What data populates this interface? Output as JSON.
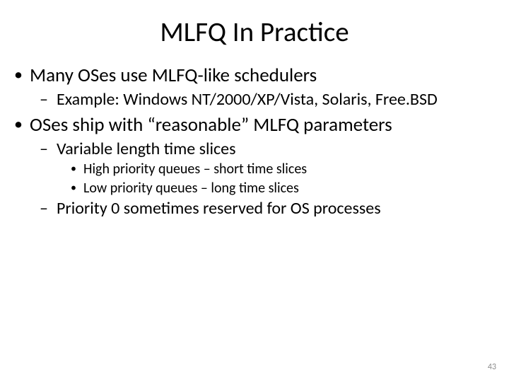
{
  "title": "MLFQ In Practice",
  "bullets": {
    "b1": "Many OSes use MLFQ-like schedulers",
    "b1_1": "Example: Windows NT/2000/XP/Vista, Solaris, Free.BSD",
    "b2": "OSes ship with “reasonable” MLFQ parameters",
    "b2_1": "Variable length time slices",
    "b2_1_1": "High priority queues – short time slices",
    "b2_1_2": "Low priority queues – long time slices",
    "b2_2": "Priority 0 sometimes reserved for OS processes"
  },
  "page_number": "43"
}
